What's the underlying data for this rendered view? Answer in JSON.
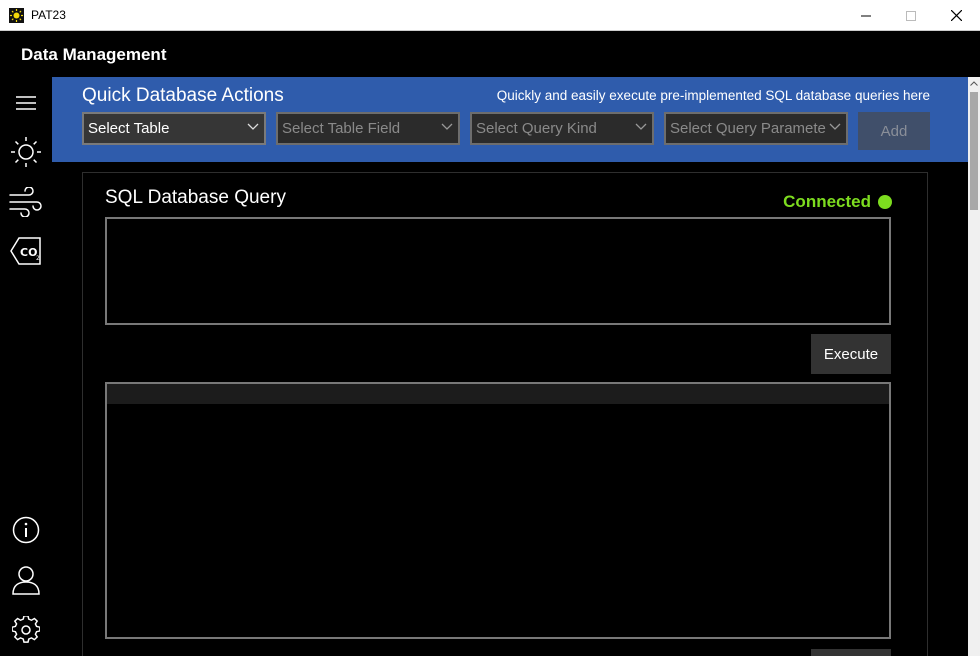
{
  "window": {
    "title": "PAT23"
  },
  "header": {
    "title": "Data Management"
  },
  "sidebar": {
    "items": [
      {
        "name": "menu",
        "icon": "hamburger-menu-icon"
      },
      {
        "name": "sun",
        "icon": "sun-icon"
      },
      {
        "name": "wind",
        "icon": "wind-icon"
      },
      {
        "name": "co2",
        "icon": "co2-icon"
      },
      {
        "name": "info",
        "icon": "info-icon"
      },
      {
        "name": "user",
        "icon": "user-icon"
      },
      {
        "name": "settings",
        "icon": "gear-icon"
      }
    ]
  },
  "quick_actions": {
    "title": "Quick Database Actions",
    "description": "Quickly and easily execute pre-implemented SQL database queries here",
    "select_table": "Select Table",
    "select_table_field": "Select Table Field",
    "select_query_kind": "Select Query Kind",
    "select_query_parameter": "Select Query Paramete",
    "add_label": "Add"
  },
  "sql_panel": {
    "title": "SQL Database Query",
    "status": "Connected",
    "query_text": "",
    "execute_label": "Execute"
  },
  "colors": {
    "accent": "#2f5cac",
    "status": "#7ddc1f",
    "background": "#000000"
  }
}
